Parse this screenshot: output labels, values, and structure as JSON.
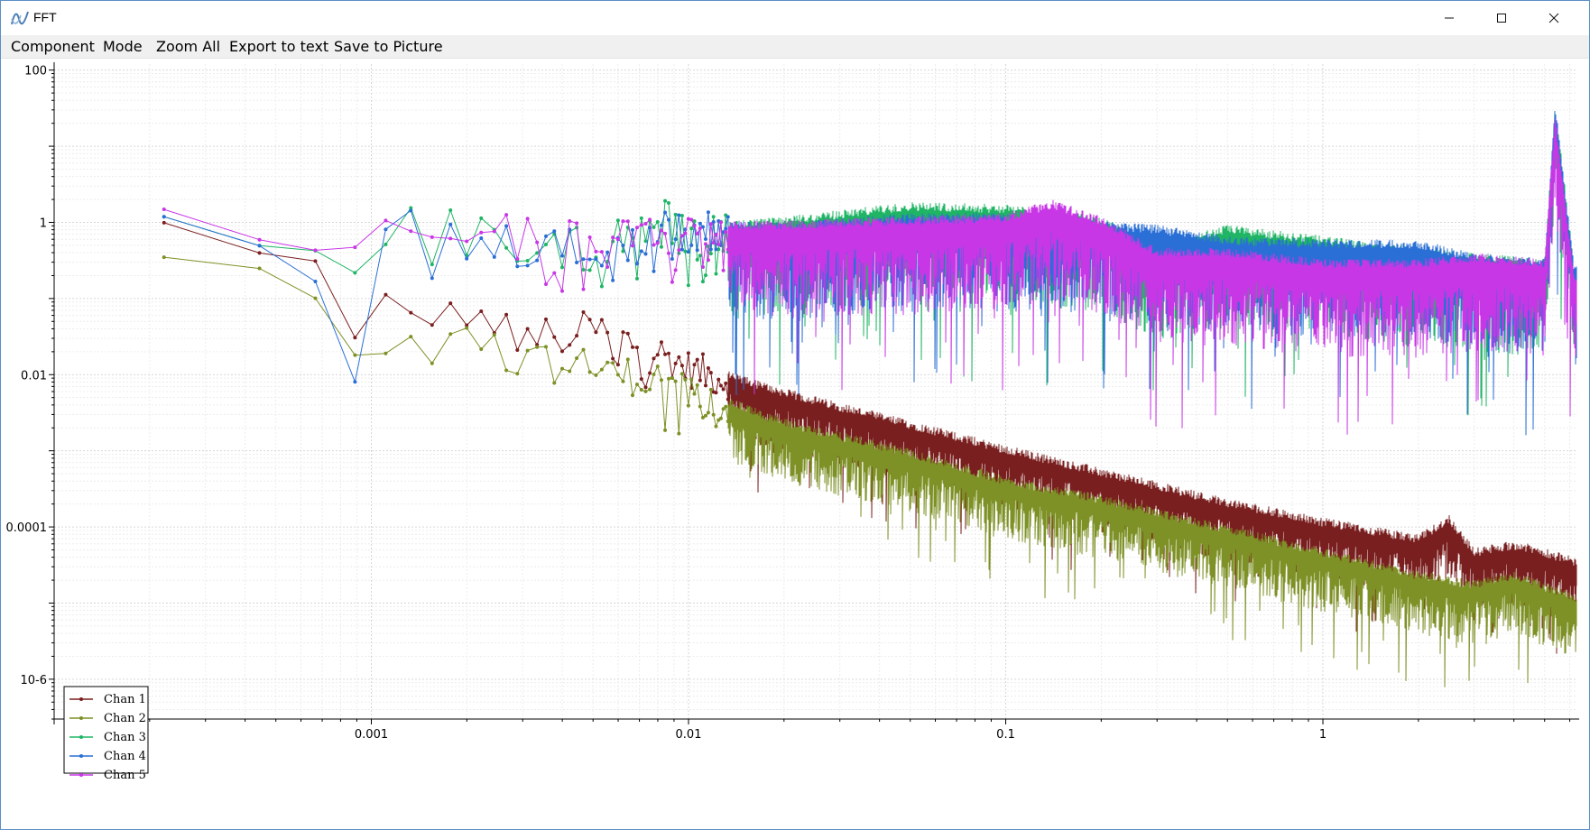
{
  "window": {
    "title": "FFT",
    "minimize_label": "–",
    "maximize_label": "□",
    "close_label": "×"
  },
  "menu": [
    {
      "label": "Component"
    },
    {
      "label": "Mode"
    },
    {
      "label": "Zoom All"
    },
    {
      "label": "Export to text"
    },
    {
      "label": "Save to Picture"
    }
  ],
  "chart_data": {
    "type": "line",
    "title": "",
    "xlabel": "",
    "ylabel": "",
    "x_scale": "log",
    "y_scale": "log",
    "xlim": [
      0.0001,
      6.3
    ],
    "ylim": [
      3e-07,
      120
    ],
    "x_ticks": [
      {
        "value": 0.001,
        "label": "0.001"
      },
      {
        "value": 0.01,
        "label": "0.01"
      },
      {
        "value": 0.1,
        "label": "0.1"
      },
      {
        "value": 1,
        "label": "1"
      }
    ],
    "y_ticks": [
      {
        "value": 100,
        "label": "100"
      },
      {
        "value": 1,
        "label": "1"
      },
      {
        "value": 0.01,
        "label": "0.01"
      },
      {
        "value": 0.0001,
        "label": "0.0001"
      },
      {
        "value": 1e-06,
        "label": "10-6"
      }
    ],
    "grid": true,
    "legend_position": "bottom-left",
    "series": [
      {
        "name": "Chan 1",
        "color": "#7a1f1f",
        "points": [
          [
            0.00022,
            1.0
          ],
          [
            0.00044,
            0.4
          ],
          [
            0.00066,
            0.28
          ],
          [
            0.00088,
            0.025
          ],
          [
            0.0011,
            0.09
          ],
          [
            0.0013,
            0.12
          ],
          [
            0.0015,
            0.03
          ],
          [
            0.0018,
            0.07
          ],
          [
            0.002,
            0.08
          ],
          [
            0.003,
            0.03
          ],
          [
            0.005,
            0.04
          ],
          [
            0.008,
            0.02
          ],
          [
            0.01,
            0.012
          ],
          [
            0.02,
            0.005
          ],
          [
            0.05,
            0.0019
          ],
          [
            0.1,
            0.0009
          ],
          [
            0.2,
            0.00045
          ],
          [
            0.5,
            0.00018
          ],
          [
            1,
            0.0001
          ],
          [
            2,
            6e-05
          ],
          [
            2.5,
            0.00011
          ],
          [
            3,
            4e-05
          ],
          [
            4,
            5e-05
          ],
          [
            5,
            4e-05
          ],
          [
            6.2,
            3e-05
          ]
        ]
      },
      {
        "name": "Chan 2",
        "color": "#7d9126",
        "points": [
          [
            0.00022,
            0.35
          ],
          [
            0.00044,
            0.25
          ],
          [
            0.00066,
            0.18
          ],
          [
            0.00088,
            0.018
          ],
          [
            0.0011,
            0.055
          ],
          [
            0.0013,
            0.06
          ],
          [
            0.0015,
            0.017
          ],
          [
            0.0018,
            0.025
          ],
          [
            0.002,
            0.04
          ],
          [
            0.003,
            0.015
          ],
          [
            0.005,
            0.012
          ],
          [
            0.008,
            0.008
          ],
          [
            0.01,
            0.006
          ],
          [
            0.02,
            0.002
          ],
          [
            0.05,
            0.0008
          ],
          [
            0.1,
            0.00035
          ],
          [
            0.2,
            0.0002
          ],
          [
            0.5,
            8e-05
          ],
          [
            1,
            4e-05
          ],
          [
            2,
            2e-05
          ],
          [
            3,
            1.5e-05
          ],
          [
            4,
            2e-05
          ],
          [
            5,
            1.4e-05
          ],
          [
            6.2,
            1e-05
          ]
        ]
      },
      {
        "name": "Chan 3",
        "color": "#1fb564",
        "points": [
          [
            0.00022,
            1.2
          ],
          [
            0.00044,
            0.5
          ],
          [
            0.00066,
            0.3
          ],
          [
            0.00088,
            0.75
          ],
          [
            0.0011,
            0.75
          ],
          [
            0.0013,
            0.95
          ],
          [
            0.0015,
            0.4
          ],
          [
            0.0018,
            0.8
          ],
          [
            0.002,
            0.7
          ],
          [
            0.003,
            0.55
          ],
          [
            0.005,
            0.45
          ],
          [
            0.008,
            1.2
          ],
          [
            0.01,
            0.7
          ],
          [
            0.02,
            0.9
          ],
          [
            0.05,
            1.4
          ],
          [
            0.1,
            1.3
          ],
          [
            0.2,
            0.9
          ],
          [
            0.3,
            0.4
          ],
          [
            0.5,
            0.7
          ],
          [
            1,
            0.5
          ],
          [
            2,
            0.35
          ],
          [
            3,
            0.3
          ],
          [
            5,
            0.25
          ],
          [
            5.4,
            28
          ],
          [
            6.2,
            0.2
          ]
        ]
      },
      {
        "name": "Chan 4",
        "color": "#2a6fd6",
        "points": [
          [
            0.00022,
            1.2
          ],
          [
            0.00044,
            0.5
          ],
          [
            0.00066,
            0.28
          ],
          [
            0.00088,
            0.0055
          ],
          [
            0.0011,
            1.1
          ],
          [
            0.0013,
            1.1
          ],
          [
            0.0015,
            0.25
          ],
          [
            0.0018,
            0.55
          ],
          [
            0.002,
            0.6
          ],
          [
            0.003,
            0.4
          ],
          [
            0.005,
            0.5
          ],
          [
            0.008,
            0.7
          ],
          [
            0.01,
            0.8
          ],
          [
            0.02,
            0.75
          ],
          [
            0.05,
            1.0
          ],
          [
            0.1,
            1.0
          ],
          [
            0.15,
            0.8
          ],
          [
            0.2,
            0.8
          ],
          [
            0.3,
            0.7
          ],
          [
            0.5,
            0.5
          ],
          [
            1,
            0.45
          ],
          [
            2,
            0.45
          ],
          [
            3,
            0.3
          ],
          [
            5,
            0.25
          ],
          [
            5.4,
            28
          ],
          [
            6.2,
            0.2
          ]
        ]
      },
      {
        "name": "Chan 5",
        "color": "#c837e6",
        "points": [
          [
            0.00022,
            1.5
          ],
          [
            0.00044,
            0.6
          ],
          [
            0.00066,
            0.32
          ],
          [
            0.00088,
            0.6
          ],
          [
            0.0011,
            1.3
          ],
          [
            0.0013,
            1.5
          ],
          [
            0.0015,
            0.55
          ],
          [
            0.0018,
            0.95
          ],
          [
            0.002,
            0.8
          ],
          [
            0.003,
            0.6
          ],
          [
            0.005,
            0.5
          ],
          [
            0.008,
            0.7
          ],
          [
            0.01,
            0.75
          ],
          [
            0.02,
            0.8
          ],
          [
            0.05,
            0.9
          ],
          [
            0.1,
            1.0
          ],
          [
            0.14,
            1.5
          ],
          [
            0.2,
            0.9
          ],
          [
            0.3,
            0.35
          ],
          [
            0.5,
            0.35
          ],
          [
            1,
            0.25
          ],
          [
            2,
            0.25
          ],
          [
            3,
            0.3
          ],
          [
            5,
            0.25
          ],
          [
            5.4,
            20
          ],
          [
            6.2,
            0.15
          ]
        ]
      }
    ]
  }
}
